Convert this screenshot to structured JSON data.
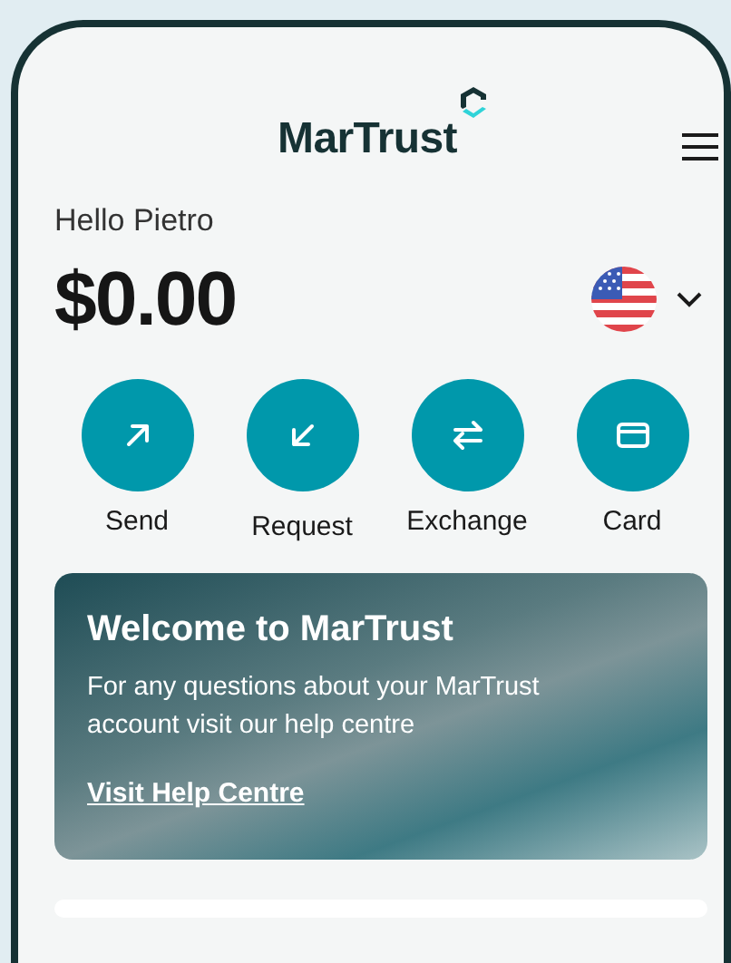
{
  "header": {
    "logo": "MarTrust"
  },
  "greeting": "Hello Pietro",
  "balance": {
    "amount": "$0.00"
  },
  "actions": [
    {
      "kind": "send",
      "label": "Send"
    },
    {
      "kind": "request",
      "label": "Request"
    },
    {
      "kind": "exchange",
      "label": "Exchange"
    },
    {
      "kind": "card",
      "label": "Card"
    }
  ],
  "banner": {
    "title": "Welcome to MarTrust",
    "text": "For any questions about your MarTrust account visit our help centre",
    "link": "Visit Help Centre"
  }
}
